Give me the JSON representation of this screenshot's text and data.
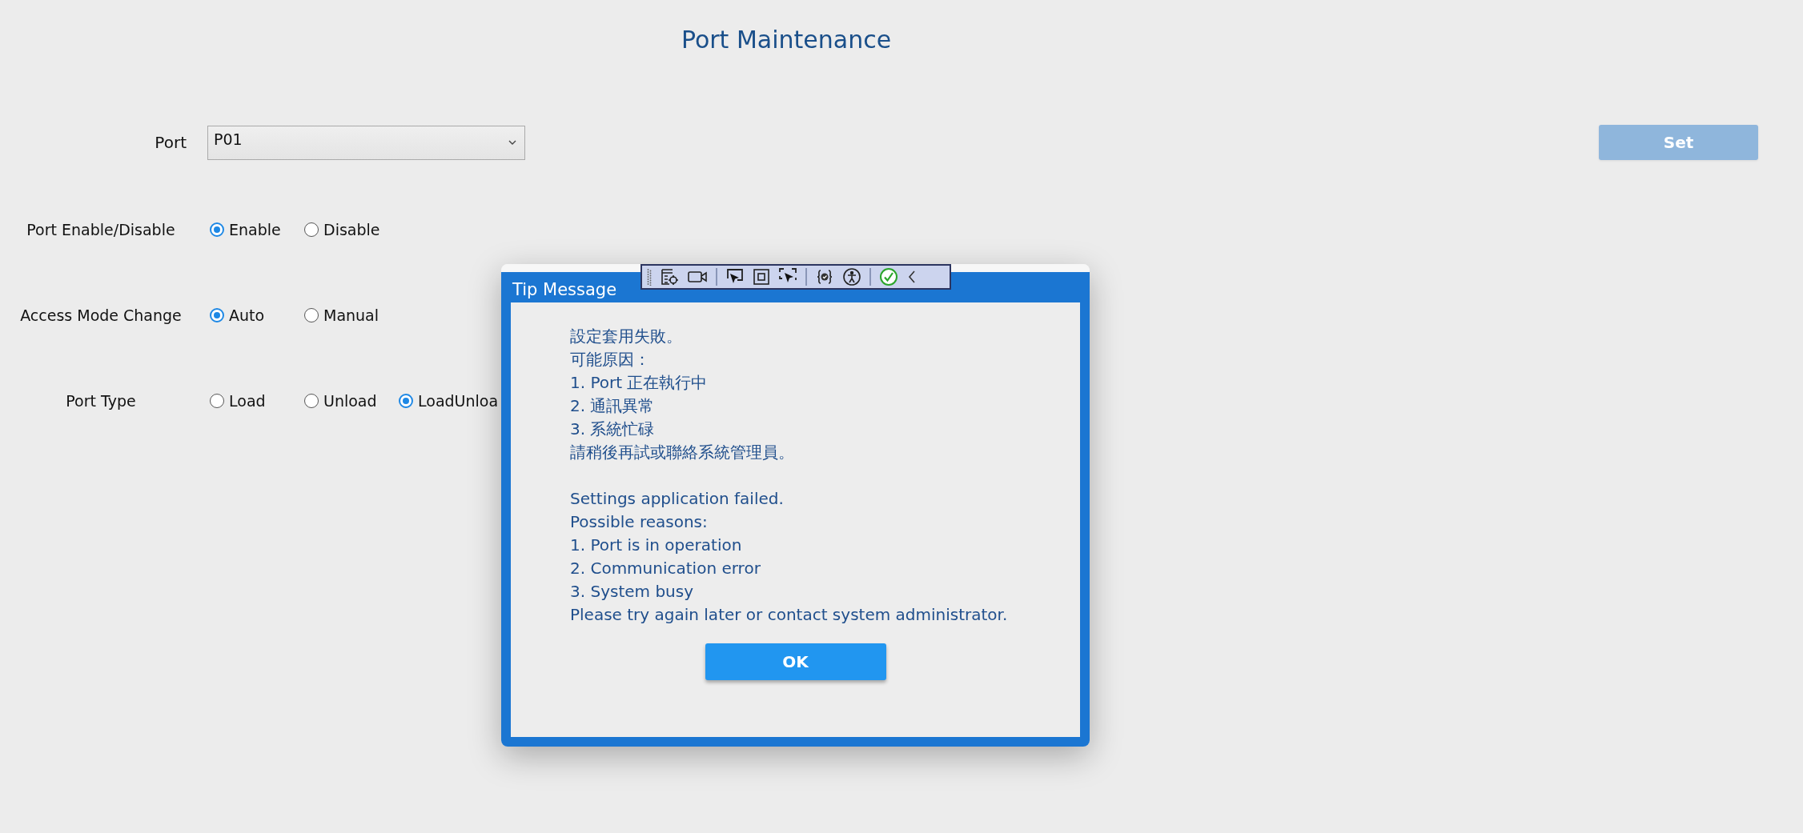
{
  "title": "Port Maintenance",
  "port_field": {
    "label": "Port",
    "value": "P01"
  },
  "set_button": {
    "label": "Set",
    "disabled": true
  },
  "radio_groups": [
    {
      "label": "Port Enable/Disable",
      "options": [
        {
          "label": "Enable",
          "selected": true
        },
        {
          "label": "Disable",
          "selected": false
        }
      ]
    },
    {
      "label": "Access Mode Change",
      "options": [
        {
          "label": "Auto",
          "selected": true
        },
        {
          "label": "Manual",
          "selected": false
        }
      ]
    },
    {
      "label": "Port Type",
      "options": [
        {
          "label": "Load",
          "selected": false
        },
        {
          "label": "Unload",
          "selected": false
        },
        {
          "label": "LoadUnloa",
          "selected": true
        }
      ]
    }
  ],
  "dialog": {
    "title": "Tip Message",
    "message_zh": [
      "設定套用失敗。",
      "可能原因：",
      "1. Port 正在執行中",
      "2. 通訊異常",
      "3. 系統忙碌",
      "請稍後再試或聯絡系統管理員。"
    ],
    "message_en": [
      "Settings application failed.",
      "Possible reasons:",
      "1. Port is in operation",
      "2. Communication error",
      "3. System busy",
      "Please try again later or contact system administrator."
    ],
    "ok_button": "OK"
  }
}
